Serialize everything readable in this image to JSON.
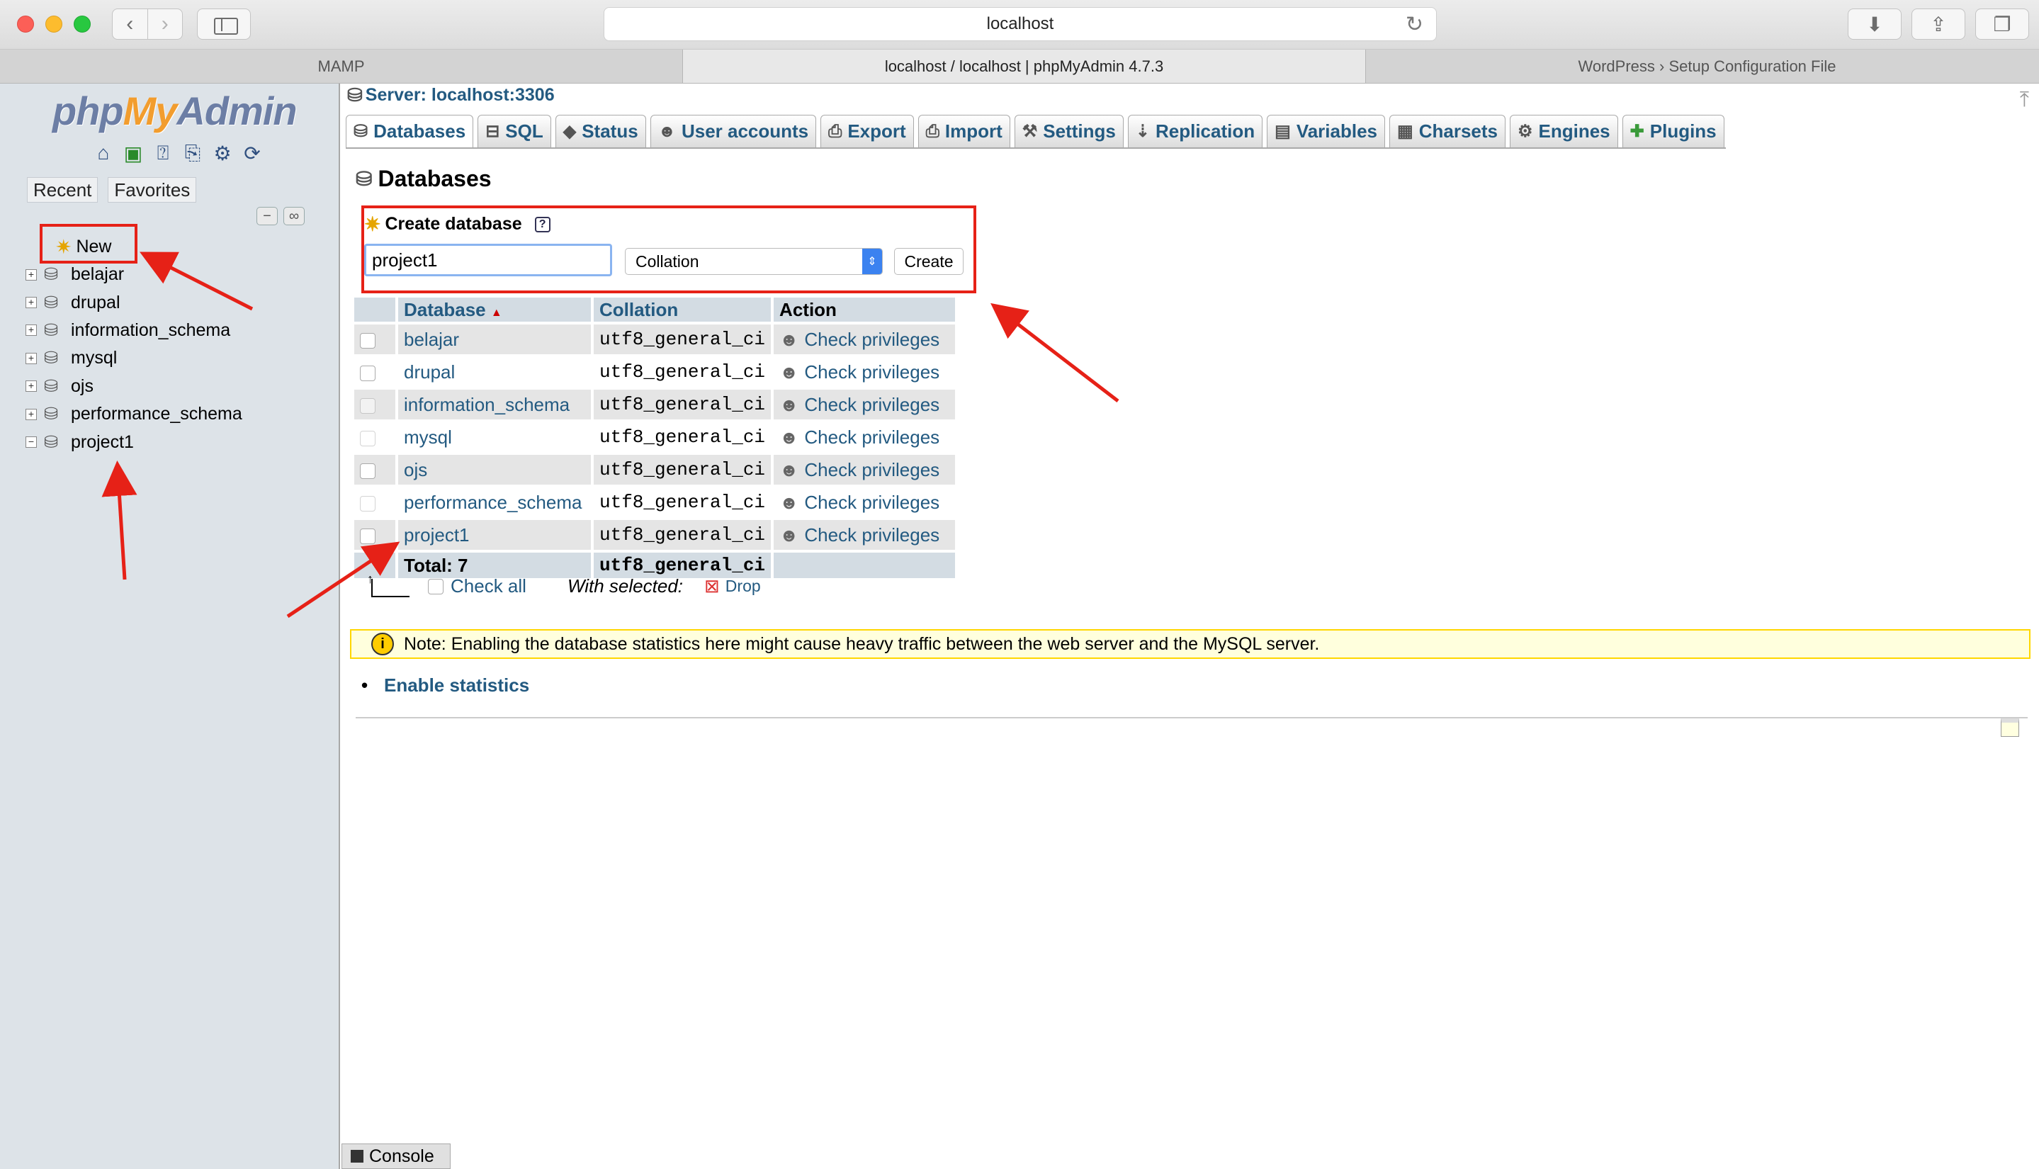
{
  "browser": {
    "address": "localhost",
    "tabs": [
      {
        "label": "MAMP"
      },
      {
        "label": "localhost / localhost | phpMyAdmin 4.7.3"
      },
      {
        "label": "WordPress › Setup Configuration File"
      }
    ]
  },
  "nav": {
    "logo_php": "php",
    "logo_my": "My",
    "logo_admin": "Admin",
    "recent": "Recent",
    "favorites": "Favorites",
    "new_label": "New",
    "databases": [
      "belajar",
      "drupal",
      "information_schema",
      "mysql",
      "ojs",
      "performance_schema",
      "project1"
    ]
  },
  "main": {
    "server": "Server: localhost:3306",
    "menu": [
      "Databases",
      "SQL",
      "Status",
      "User accounts",
      "Export",
      "Import",
      "Settings",
      "Replication",
      "Variables",
      "Charsets",
      "Engines",
      "Plugins"
    ],
    "title": "Databases",
    "create": {
      "heading": "Create database",
      "name_value": "project1",
      "collation": "Collation",
      "button": "Create"
    },
    "table": {
      "headers": {
        "database": "Database",
        "collation": "Collation",
        "action": "Action"
      },
      "rows": [
        {
          "name": "belajar",
          "collation": "utf8_general_ci",
          "action": "Check privileges"
        },
        {
          "name": "drupal",
          "collation": "utf8_general_ci",
          "action": "Check privileges"
        },
        {
          "name": "information_schema",
          "collation": "utf8_general_ci",
          "action": "Check privileges"
        },
        {
          "name": "mysql",
          "collation": "utf8_general_ci",
          "action": "Check privileges"
        },
        {
          "name": "ojs",
          "collation": "utf8_general_ci",
          "action": "Check privileges"
        },
        {
          "name": "performance_schema",
          "collation": "utf8_general_ci",
          "action": "Check privileges"
        },
        {
          "name": "project1",
          "collation": "utf8_general_ci",
          "action": "Check privileges"
        }
      ],
      "total_label": "Total: 7",
      "total_collation": "utf8_general_ci"
    },
    "check_all": "Check all",
    "with_selected": "With selected:",
    "drop": "Drop",
    "notice": "Note: Enabling the database statistics here might cause heavy traffic between the web server and the MySQL server.",
    "enable_stats": "Enable statistics",
    "console": "Console"
  },
  "colors": {
    "link": "#235a81",
    "annotation": "#e62117",
    "notice_border": "#ffd700"
  }
}
